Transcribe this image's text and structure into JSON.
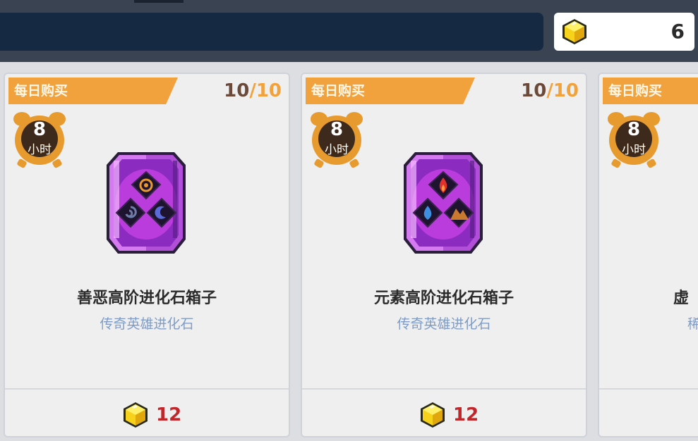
{
  "header": {
    "currency": {
      "icon": "yellow-cube-gem-icon",
      "amount": "6"
    }
  },
  "shop": {
    "items": [
      {
        "tag": "每日购买",
        "limit_current": "10",
        "limit_sep": "/",
        "limit_max": "10",
        "timer_value": "8",
        "timer_unit": "小时",
        "chest_icon": "good-evil-chest-icon",
        "name": "善恶高阶进化石箱子",
        "subtitle": "传奇英雄进化石",
        "price": "12"
      },
      {
        "tag": "每日购买",
        "limit_current": "10",
        "limit_sep": "/",
        "limit_max": "10",
        "timer_value": "8",
        "timer_unit": "小时",
        "chest_icon": "elemental-chest-icon",
        "name": "元素高阶进化石箱子",
        "subtitle": "传奇英雄进化石",
        "price": "12"
      },
      {
        "tag": "每日购买",
        "timer_value": "8",
        "timer_unit": "小时",
        "name": "虚",
        "subtitle": "稀"
      }
    ]
  },
  "colors": {
    "tag_orange": "#f2a23c",
    "price_red": "#c0262a",
    "subtitle_blue": "#7f9cc6",
    "header_bar": "#152942"
  }
}
